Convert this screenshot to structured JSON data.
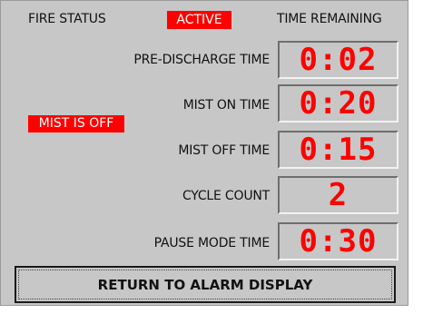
{
  "header": {
    "fire_status_label": "FIRE STATUS",
    "fire_status_value": "ACTIVE",
    "time_remaining_label": "TIME REMAINING"
  },
  "mist_status": "MIST IS OFF",
  "rows": [
    {
      "label": "PRE-DISCHARGE TIME",
      "value": "0:02"
    },
    {
      "label": "MIST ON TIME",
      "value": "0:20"
    },
    {
      "label": "MIST OFF TIME",
      "value": "0:15"
    },
    {
      "label": "CYCLE COUNT",
      "value": "2"
    },
    {
      "label": "PAUSE MODE TIME",
      "value": "0:30"
    }
  ],
  "return_button_label": "RETURN TO ALARM DISPLAY",
  "colors": {
    "panel": "#c7c7c7",
    "alert_red": "#ff0000",
    "text": "#111111"
  }
}
